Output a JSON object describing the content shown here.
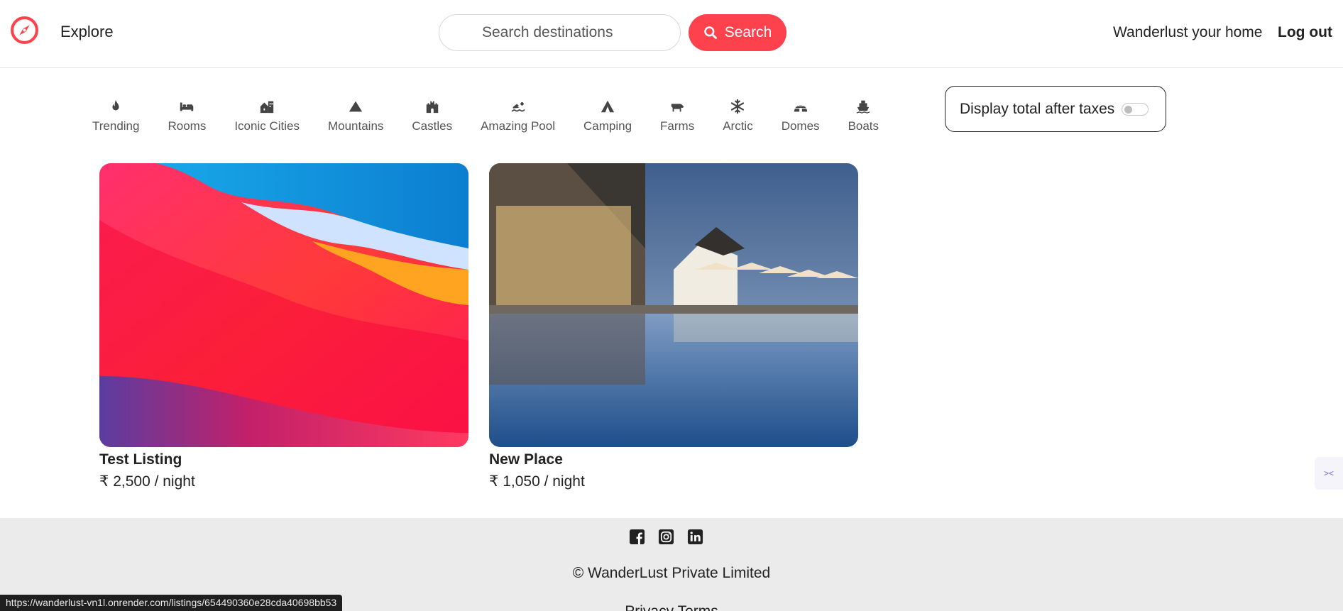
{
  "navbar": {
    "explore_label": "Explore",
    "search_placeholder": "Search destinations",
    "search_button_label": "Search",
    "home_link_label": "Wanderlust your home",
    "logout_label": "Log out",
    "accent_color": "#fe424d"
  },
  "filters": [
    {
      "label": "Trending",
      "icon": "fire-icon"
    },
    {
      "label": "Rooms",
      "icon": "bed-icon"
    },
    {
      "label": "Iconic Cities",
      "icon": "city-icon"
    },
    {
      "label": "Mountains",
      "icon": "mountain-icon"
    },
    {
      "label": "Castles",
      "icon": "castle-icon"
    },
    {
      "label": "Amazing Pool",
      "icon": "swimmer-icon"
    },
    {
      "label": "Camping",
      "icon": "tent-icon"
    },
    {
      "label": "Farms",
      "icon": "cow-icon"
    },
    {
      "label": "Arctic",
      "icon": "snowflake-icon"
    },
    {
      "label": "Domes",
      "icon": "igloo-icon"
    },
    {
      "label": "Boats",
      "icon": "ship-icon"
    }
  ],
  "tax_toggle": {
    "label": "Display total after taxes",
    "checked": false
  },
  "listings": [
    {
      "title": "Test Listing",
      "price": "₹ 2,500 / night"
    },
    {
      "title": "New Place",
      "price": "₹ 1,050 / night"
    }
  ],
  "footer": {
    "socials": [
      "facebook-icon",
      "instagram-icon",
      "linkedin-icon"
    ],
    "copyright": "© WanderLust Private Limited",
    "links": "Privacy Terms"
  },
  "statusbar": {
    "url": "https://wanderlust-vn1l.onrender.com/listings/654490360e28cda40698bb53"
  }
}
